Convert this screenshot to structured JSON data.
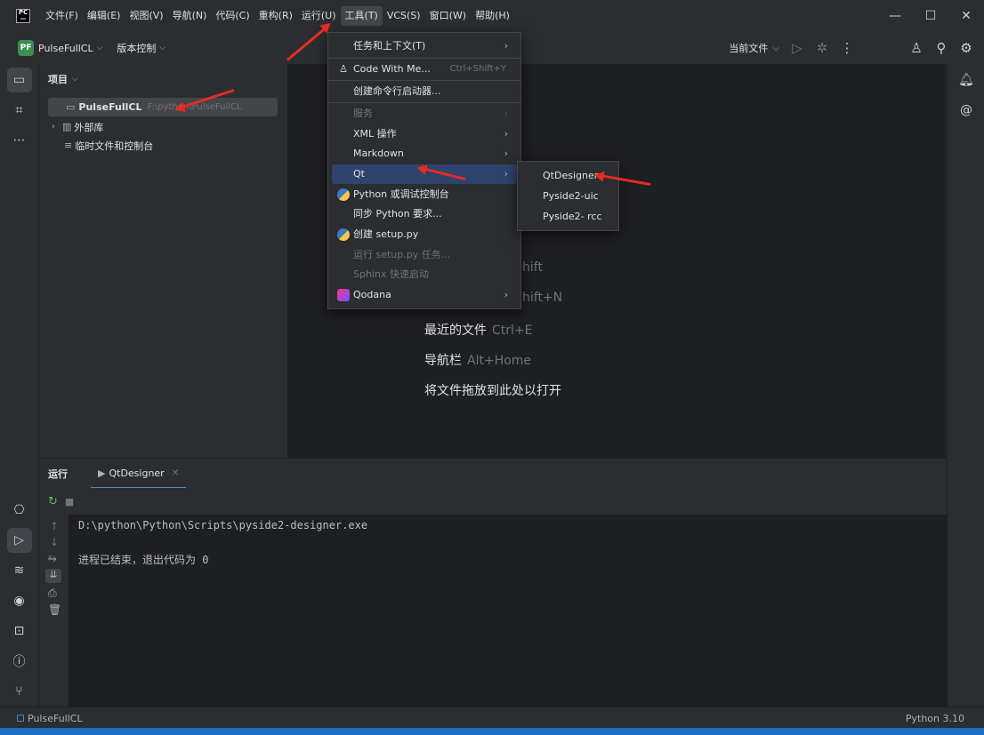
{
  "menubar": {
    "items": [
      "文件(F)",
      "编辑(E)",
      "视图(V)",
      "导航(N)",
      "代码(C)",
      "重构(R)",
      "运行(U)",
      "工具(T)",
      "VCS(S)",
      "窗口(W)",
      "帮助(H)"
    ],
    "active": "工具(T)"
  },
  "toolbar": {
    "project_badge": "PF",
    "project_name": "PulseFullCL",
    "vcs_label": "版本控制",
    "run_config": "当前文件"
  },
  "project_panel": {
    "title": "项目",
    "root_name": "PulseFullCL",
    "root_path": "F:\\python\\PulseFullCL",
    "external_libs": "外部库",
    "scratches": "临时文件和控制台"
  },
  "editor_hints": {
    "partial1": "hift",
    "partial2": "hift+N",
    "recent_label": "最近的文件",
    "recent_key": "Ctrl+E",
    "navbar_label": "导航栏",
    "navbar_key": "Alt+Home",
    "drop_label": "将文件拖放到此处以打开"
  },
  "tools_menu": {
    "items": [
      {
        "label": "任务和上下文(T)",
        "submenu": true
      },
      {
        "label": "Code With Me...",
        "shortcut": "Ctrl+Shift+Y"
      },
      {
        "label": "创建命令行启动器..."
      },
      {
        "label": "服务",
        "disabled": true,
        "submenu": true
      },
      {
        "label": "XML 操作",
        "submenu": true
      },
      {
        "label": "Markdown",
        "submenu": true
      },
      {
        "label": "Qt",
        "submenu": true,
        "selected": true
      },
      {
        "label": "Python 或调试控制台"
      },
      {
        "label": "同步 Python 要求..."
      },
      {
        "label": "创建 setup.py"
      },
      {
        "label": "运行 setup.py 任务...",
        "disabled": true
      },
      {
        "label": "Sphinx 快速启动",
        "disabled": true
      },
      {
        "label": "Qodana",
        "submenu": true
      }
    ]
  },
  "qt_submenu": {
    "items": [
      "QtDesigner",
      "Pyside2-uic",
      "Pyside2- rcc"
    ]
  },
  "run_panel": {
    "title": "运行",
    "tab_label": "QtDesigner",
    "console_line1": "D:\\python\\Python\\Scripts\\pyside2-designer.exe",
    "console_line2": "进程已结束，退出代码为 0"
  },
  "statusbar": {
    "project": "PulseFullCL",
    "interpreter": "Python 3.10"
  },
  "colors": {
    "accent": "#2e436e",
    "annotation_arrow": "#e52b22",
    "bottom_edge": "#1f6fc5"
  }
}
